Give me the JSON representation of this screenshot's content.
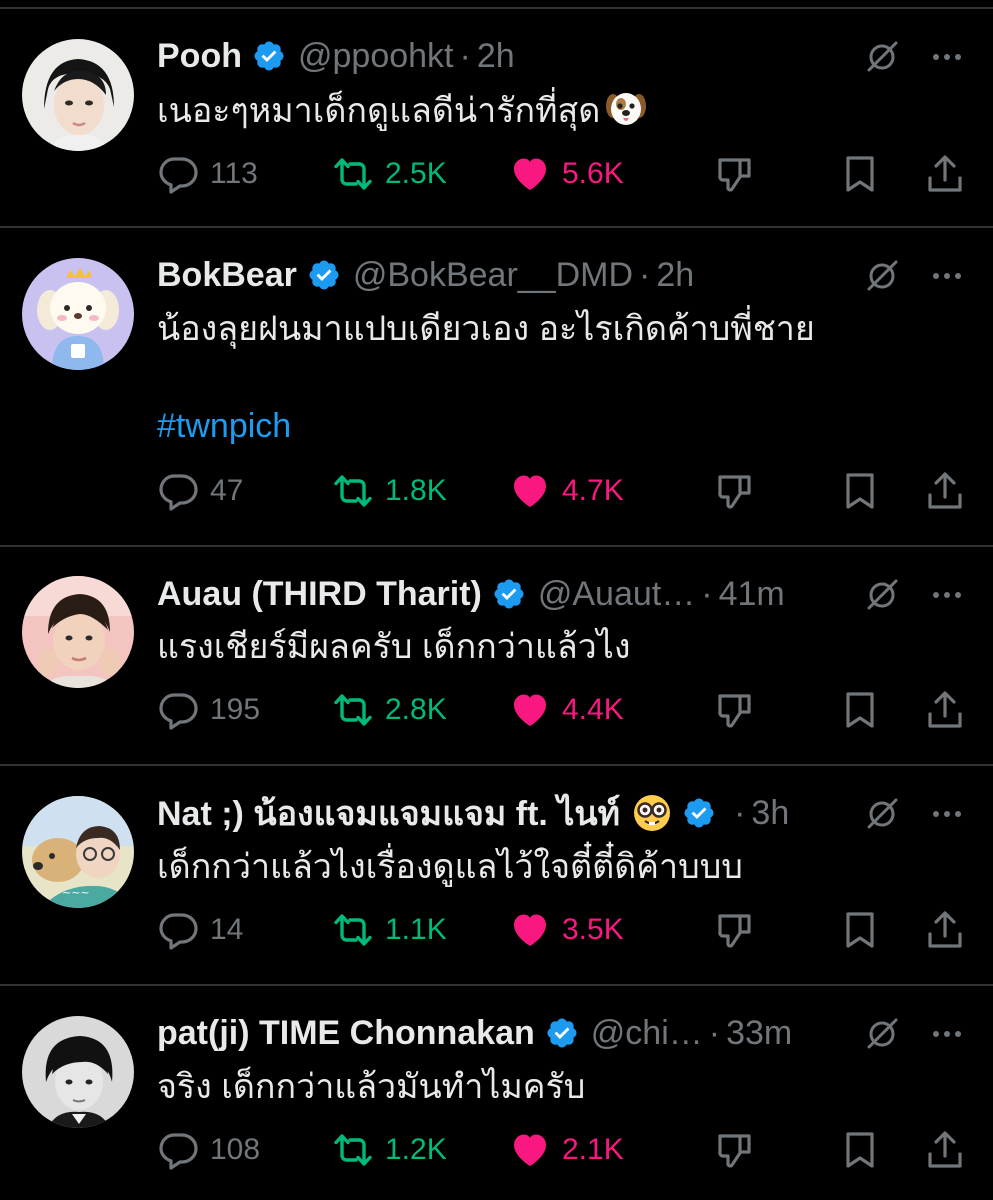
{
  "colors": {
    "background": "#000000",
    "text": "#e7e9ea",
    "muted": "#71767b",
    "retweet": "#00ba7c",
    "like": "#f91880",
    "hashtag": "#1d9bf0",
    "verified": "#1d9bf0"
  },
  "tweets": [
    {
      "name": "Pooh",
      "handle": "@ppoohkt",
      "separator": "·",
      "time": "2h",
      "text": "เนอะๆหมาเด็กดูแลดีน่ารักที่สุด",
      "text_emoji_icon": "dog-face-emoji",
      "replies": "113",
      "retweets": "2.5K",
      "likes": "5.6K"
    },
    {
      "name": "BokBear",
      "handle": "@BokBear__DMD",
      "separator": "·",
      "time": "2h",
      "text": "น้องลุยฝนมาแปบเดียวเอง อะไรเกิดค้าบพี่ชาย",
      "hashtag": "#twnpich",
      "replies": "47",
      "retweets": "1.8K",
      "likes": "4.7K"
    },
    {
      "name": "Auau (THIRD Tharit)",
      "handle": "@Auaut…",
      "separator": "·",
      "time": "41m",
      "text": "แรงเชียร์มีผลครับ เด็กกว่าแล้วไง",
      "replies": "195",
      "retweets": "2.8K",
      "likes": "4.4K"
    },
    {
      "name": "Nat ;) น้องแจมแจมแจม ft. ไนท์",
      "name_emoji_icon": "nerd-face-emoji",
      "separator": "·",
      "time": "3h",
      "text": "เด็กกว่าแล้วไงเรื่องดูแลไว้ใจตี๋ตี๋ดิค้าบบบ",
      "replies": "14",
      "retweets": "1.1K",
      "likes": "3.5K"
    },
    {
      "name": "pat(ji) TIME Chonnakan",
      "handle": "@chi…",
      "separator": "·",
      "time": "33m",
      "text": "จริง เด็กกว่าแล้วมันทำไมครับ",
      "replies": "108",
      "retweets": "1.2K",
      "likes": "2.1K"
    }
  ]
}
